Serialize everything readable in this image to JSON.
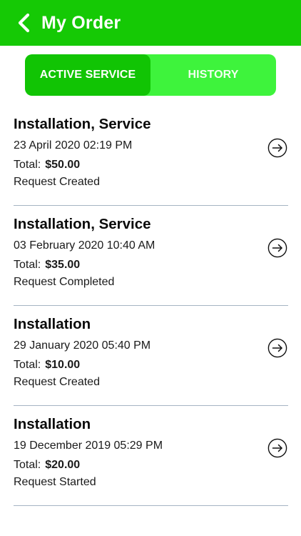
{
  "header": {
    "title": "My Order",
    "back_icon": "chevron-left-icon",
    "background_color": "#15c905"
  },
  "tabs": [
    {
      "label": "ACTIVE SERVICE",
      "active": true
    },
    {
      "label": "HISTORY",
      "active": false
    }
  ],
  "orders": [
    {
      "title": "Installation, Service",
      "date": "23 April 2020 02:19 PM",
      "total_label": "Total:",
      "total_value": "$50.00",
      "status": "Request Created",
      "action_icon": "arrow-right-circle-icon"
    },
    {
      "title": "Installation, Service",
      "date": "03 February 2020 10:40 AM",
      "total_label": "Total:",
      "total_value": "$35.00",
      "status": "Request Completed",
      "action_icon": "arrow-right-circle-icon"
    },
    {
      "title": "Installation",
      "date": "29 January 2020 05:40 PM",
      "total_label": "Total:",
      "total_value": "$10.00",
      "status": "Request Created",
      "action_icon": "arrow-right-circle-icon"
    },
    {
      "title": "Installation",
      "date": "19 December 2019 05:29 PM",
      "total_label": "Total:",
      "total_value": "$20.00",
      "status": "Request Started",
      "action_icon": "arrow-right-circle-icon"
    }
  ]
}
